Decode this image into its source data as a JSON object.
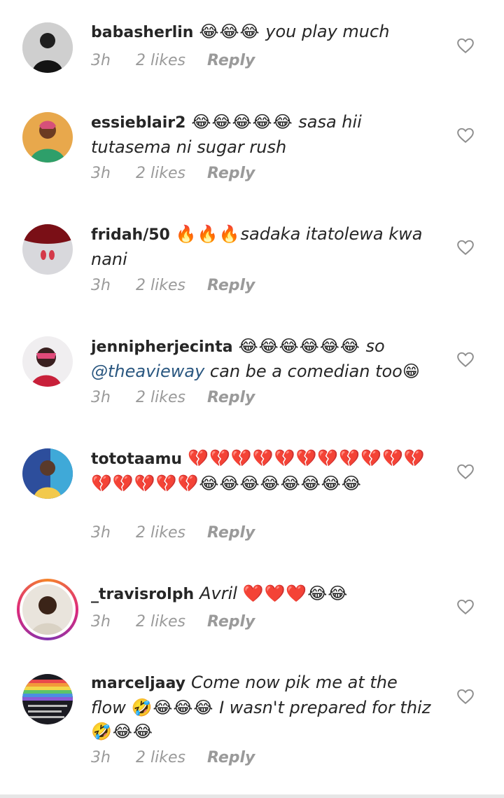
{
  "comments": [
    {
      "username": "babasherlin",
      "emoji_a": "😂😂😂",
      "text_a": " you play much",
      "time": "3h",
      "likes": "2 likes",
      "reply": "Reply"
    },
    {
      "username": "essieblair2",
      "emoji_a": "😂😂😂😂😂",
      "text_a": " sasa hii tutasema ni sugar rush",
      "time": "3h",
      "likes": "2 likes",
      "reply": "Reply"
    },
    {
      "username": "fridah/50",
      "emoji_a": "🔥🔥🔥",
      "text_a": "sadaka  itatolewa kwa nani",
      "time": "3h",
      "likes": "2 likes",
      "reply": "Reply"
    },
    {
      "username": "jennipherjecinta",
      "emoji_a": "😂😂😂😂😂😂",
      "text_a": " so ",
      "mention": "@theavieway",
      "text_b": "  can be a comedian too",
      "emoji_b": "😁",
      "time": "3h",
      "likes": "2 likes",
      "reply": "Reply"
    },
    {
      "username": "tototaamu",
      "emoji_a": "💔💔💔💔💔💔💔💔💔💔💔💔💔💔💔💔😂😂😂😂😂😂😂😂",
      "time": "3h",
      "likes": "2 likes",
      "reply": "Reply"
    },
    {
      "username": "_travisrolph",
      "text_a": "Avril ",
      "emoji_a": "❤️❤️❤️😂😂",
      "time": "3h",
      "likes": "2 likes",
      "reply": "Reply"
    },
    {
      "username": "marceljaay",
      "text_a": "Come now pik me at the flow ",
      "emoji_a": "🤣😂😂😂",
      "text_b": " I wasn't prepared for thiz",
      "emoji_b": "🤣😂😂",
      "time": "3h",
      "likes": "2 likes",
      "reply": "Reply"
    }
  ],
  "colors": {
    "username": "#262626",
    "meta": "#9a9a9a",
    "mention": "#2a5780",
    "heart_icon": "heart-outline-icon"
  }
}
